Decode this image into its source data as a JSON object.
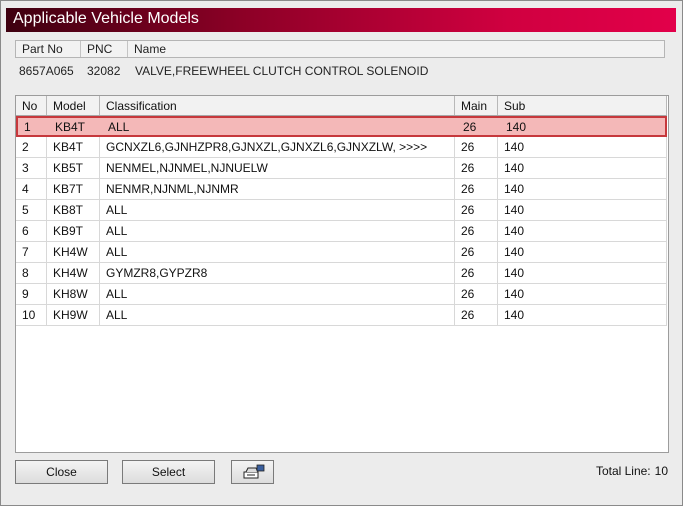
{
  "window": {
    "title": "Applicable Vehicle Models"
  },
  "part": {
    "headers": {
      "part_no": "Part No",
      "pnc": "PNC",
      "name": "Name"
    },
    "part_no": "8657A065",
    "pnc": "32082",
    "name": "VALVE,FREEWHEEL CLUTCH CONTROL SOLENOID"
  },
  "table": {
    "headers": {
      "no": "No",
      "model": "Model",
      "classification": "Classification",
      "main": "Main",
      "sub": "Sub"
    },
    "selected_index": 0,
    "rows": [
      {
        "no": "1",
        "model": "KB4T",
        "classification": "ALL",
        "main": "26",
        "sub": "140"
      },
      {
        "no": "2",
        "model": "KB4T",
        "classification": "GCNXZL6,GJNHZPR8,GJNXZL,GJNXZL6,GJNXZLW,  >>>>",
        "main": "26",
        "sub": "140"
      },
      {
        "no": "3",
        "model": "KB5T",
        "classification": "NENMEL,NJNMEL,NJNUELW",
        "main": "26",
        "sub": "140"
      },
      {
        "no": "4",
        "model": "KB7T",
        "classification": "NENMR,NJNML,NJNMR",
        "main": "26",
        "sub": "140"
      },
      {
        "no": "5",
        "model": "KB8T",
        "classification": "ALL",
        "main": "26",
        "sub": "140"
      },
      {
        "no": "6",
        "model": "KB9T",
        "classification": "ALL",
        "main": "26",
        "sub": "140"
      },
      {
        "no": "7",
        "model": "KH4W",
        "classification": "ALL",
        "main": "26",
        "sub": "140"
      },
      {
        "no": "8",
        "model": "KH4W",
        "classification": "GYMZR8,GYPZR8",
        "main": "26",
        "sub": "140"
      },
      {
        "no": "9",
        "model": "KH8W",
        "classification": "ALL",
        "main": "26",
        "sub": "140"
      },
      {
        "no": "10",
        "model": "KH9W",
        "classification": "ALL",
        "main": "26",
        "sub": "140"
      }
    ]
  },
  "footer": {
    "close_label": "Close",
    "select_label": "Select",
    "print_icon": "printer-icon",
    "total_label": "Total Line:",
    "total_value": "10"
  },
  "colors": {
    "title_dark": "#3e0010",
    "title_light": "#e2004a",
    "selected_row_bg": "#f4b8b8",
    "selected_row_border": "#c6383c"
  }
}
